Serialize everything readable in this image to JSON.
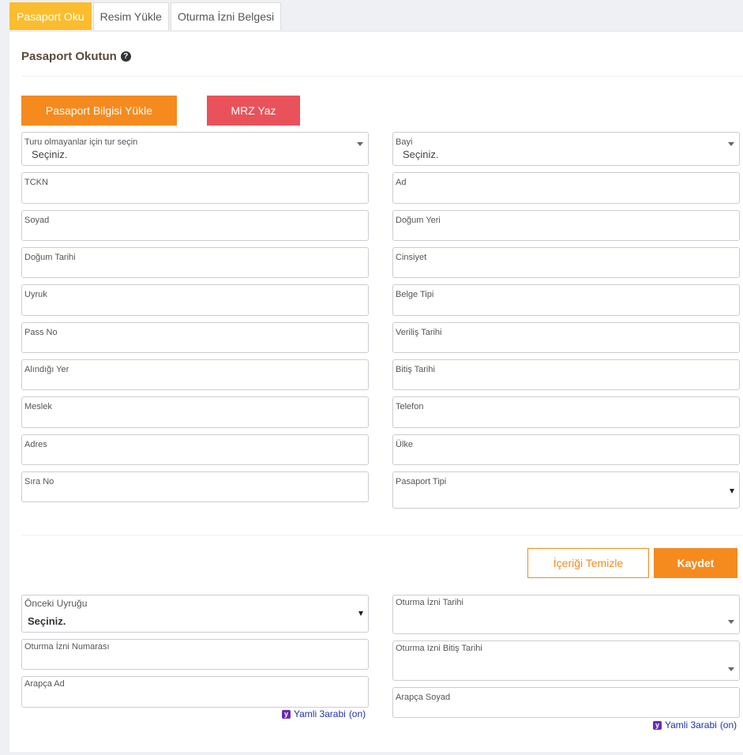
{
  "tabs": [
    {
      "label": "Pasaport Oku"
    },
    {
      "label": "Resim Yükle"
    },
    {
      "label": "Oturma İzni Belgesi"
    }
  ],
  "section_title": "Pasaport Okutun",
  "buttons": {
    "load_passport": "Pasaport Bilgisi Yükle",
    "mrz": "MRZ Yaz",
    "clear": "İçeriği Temizle",
    "save": "Kaydet"
  },
  "fields": {
    "type_select": {
      "label": "Turu olmayanlar için tur seçin",
      "value": "Seçiniz."
    },
    "dealer": {
      "label": "Bayi",
      "value": "Seçiniz."
    },
    "tckn": {
      "label": "TCKN",
      "value": ""
    },
    "first_name": {
      "label": "Ad",
      "value": ""
    },
    "last_name": {
      "label": "Soyad",
      "value": ""
    },
    "birth_place": {
      "label": "Doğum Yeri",
      "value": ""
    },
    "birth_date": {
      "label": "Doğum Tarihi",
      "value": ""
    },
    "gender": {
      "label": "Cinsiyet",
      "value": ""
    },
    "nationality": {
      "label": "Uyruk",
      "value": ""
    },
    "document_type": {
      "label": "Belge Tipi",
      "value": ""
    },
    "pass_no": {
      "label": "Pass No",
      "value": ""
    },
    "issue_date": {
      "label": "Veriliş Tarihi",
      "value": ""
    },
    "issue_place": {
      "label": "Alındığı Yer",
      "value": ""
    },
    "expiry_date": {
      "label": "Bitiş Tarihi",
      "value": ""
    },
    "occupation": {
      "label": "Meslek",
      "value": ""
    },
    "phone": {
      "label": "Telefon",
      "value": ""
    },
    "address": {
      "label": "Adres",
      "value": ""
    },
    "country": {
      "label": "Ülke",
      "value": ""
    },
    "sequence_no": {
      "label": "Sıra No",
      "value": ""
    },
    "passport_type": {
      "label": "Pasaport Tipi",
      "value": ""
    },
    "previous_nationality": {
      "label": "Önceki Uyruğu",
      "value": "Seçiniz."
    },
    "residence_date": {
      "label": "Oturma İzni Tarihi",
      "value": ""
    },
    "residence_number": {
      "label": "Oturma İzni Numarası",
      "value": ""
    },
    "residence_end_date": {
      "label": "Oturma Izni Bitiş Tarihi",
      "value": ""
    },
    "arabic_first_name": {
      "label": "Arapça Ad",
      "value": ""
    },
    "arabic_last_name": {
      "label": "Arapça Soyad",
      "value": ""
    }
  },
  "yamli": {
    "label": "Yamli 3arabi",
    "state": "(on)"
  },
  "colors": {
    "accent_orange": "#f58a1f",
    "tab_active": "#fbbd2e",
    "mrz_red": "#e9525a"
  }
}
